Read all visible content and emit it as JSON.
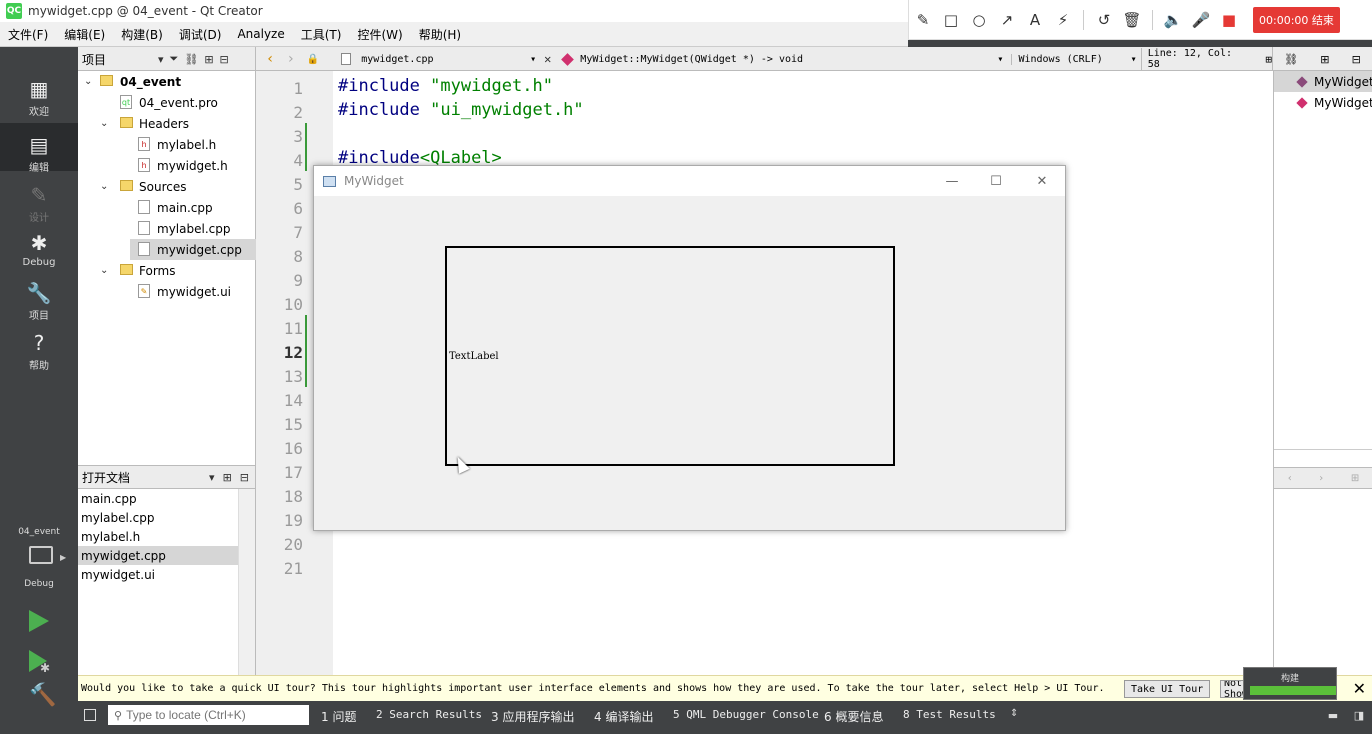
{
  "window": {
    "title": "mywidget.cpp @ 04_event - Qt Creator",
    "logo": "QC"
  },
  "recorder": {
    "timer": "00:00:00 结束"
  },
  "menu": [
    "文件(F)",
    "编辑(E)",
    "构建(B)",
    "调试(D)",
    "Analyze",
    "工具(T)",
    "控件(W)",
    "帮助(H)"
  ],
  "project_toolbar": {
    "label": "项目"
  },
  "editor_toolbar": {
    "filename": "mywidget.cpp",
    "symbol": "MyWidget::MyWidget(QWidget *) -> void",
    "encoding": "Windows (CRLF)",
    "position": "Line: 12, Col: 58"
  },
  "modes": [
    {
      "label": "欢迎",
      "icon": "grid-icon"
    },
    {
      "label": "编辑",
      "icon": "document-icon"
    },
    {
      "label": "设计",
      "icon": "pencil-icon"
    },
    {
      "label": "Debug",
      "icon": "bug-icon"
    },
    {
      "label": "项目",
      "icon": "wrench-icon"
    },
    {
      "label": "帮助",
      "icon": "question-icon"
    }
  ],
  "kit": {
    "name": "04_event",
    "config": "Debug"
  },
  "project_tree": {
    "root": "04_event",
    "pro": "04_event.pro",
    "headers": "Headers",
    "header_files": [
      "mylabel.h",
      "mywidget.h"
    ],
    "sources": "Sources",
    "source_files": [
      "main.cpp",
      "mylabel.cpp",
      "mywidget.cpp"
    ],
    "forms": "Forms",
    "form_files": [
      "mywidget.ui"
    ]
  },
  "open_docs": {
    "title": "打开文档",
    "files": [
      "main.cpp",
      "mylabel.cpp",
      "mylabel.h",
      "mywidget.cpp",
      "mywidget.ui"
    ],
    "selected": "mywidget.cpp"
  },
  "editor": {
    "line_numbers": [
      "1",
      "2",
      "3",
      "4",
      "5",
      "6",
      "7",
      "8",
      "9",
      "10",
      "11",
      "12",
      "13",
      "14",
      "15",
      "16",
      "17",
      "18",
      "19",
      "20",
      "21"
    ],
    "current_line": "12",
    "lines": [
      {
        "kw": "#include ",
        "str": "\"mywidget.h\""
      },
      {
        "kw": "#include ",
        "str": "\"ui_mywidget.h\""
      },
      {
        "kw": "#include",
        "str": "<QLabel>"
      }
    ]
  },
  "outline": [
    "MyWidget",
    "MyWidget"
  ],
  "app_window": {
    "title": "MyWidget",
    "label_text": "TextLabel"
  },
  "infobar": {
    "message": "Would you like to take a quick UI tour? This tour highlights important user interface elements and shows how they are used. To take the tour later, select Help > UI Tour.",
    "tour_button": "Take UI Tour",
    "dismiss_button": "Do Not Show Again"
  },
  "build_progress": {
    "label": "构建",
    "fraction": 1.0,
    "color": "#5bbf3a"
  },
  "status_bar": {
    "locator_placeholder": "Type to locate (Ctrl+K)",
    "panes": [
      "1 问题",
      "2 Search Results",
      "3 应用程序输出",
      "4 编译输出",
      "5 QML Debugger Console",
      "6 概要信息",
      "8 Test Results"
    ]
  },
  "colors": {
    "run": "#4caf50",
    "timer_bg": "#e53935",
    "sidebar": "#404244",
    "git_mark": "#3a9a3a"
  }
}
